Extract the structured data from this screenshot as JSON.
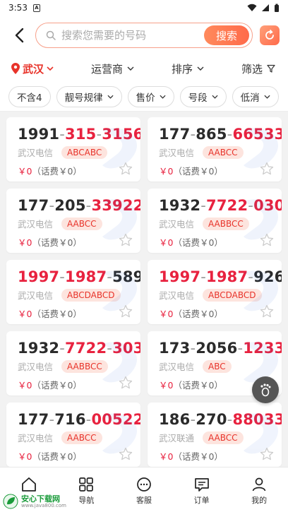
{
  "status": {
    "time": "3:53"
  },
  "search": {
    "placeholder": "搜索您需要的号码",
    "button": "搜索"
  },
  "filters": {
    "city": "武汉",
    "operator": "运营商",
    "sort": "排序",
    "screen": "筛选"
  },
  "tags": [
    "不含4",
    "靓号规律",
    "售价",
    "号段",
    "低消"
  ],
  "numbers": [
    {
      "p1": "1991",
      "p2": "315",
      "p3": "3156",
      "hl": [
        false,
        true,
        true
      ],
      "carrier": "武汉电信",
      "pattern": "ABCABC",
      "price": "￥0",
      "fee": "（话费￥0）"
    },
    {
      "p1": "177",
      "p2": "865",
      "p3": "66533",
      "hl": [
        false,
        false,
        true
      ],
      "carrier": "武汉电信",
      "pattern": "AABCC",
      "price": "￥0",
      "fee": "（话费￥0）"
    },
    {
      "p1": "177",
      "p2": "205",
      "p3": "33922",
      "hl": [
        false,
        false,
        true
      ],
      "carrier": "武汉电信",
      "pattern": "AABCC",
      "price": "￥0",
      "fee": "（话费￥0）"
    },
    {
      "p1": "1932",
      "p2": "7722",
      "p3": "030",
      "hl": [
        false,
        true,
        true
      ],
      "carrier": "武汉电信",
      "pattern": "AABBCC",
      "price": "￥0",
      "fee": "（话费￥0）"
    },
    {
      "p1": "1997",
      "p2": "1987",
      "p3": "589",
      "hl": [
        true,
        true,
        false
      ],
      "carrier": "武汉电信",
      "pattern": "ABCDABCD",
      "price": "￥0",
      "fee": "（话费￥0）"
    },
    {
      "p1": "1997",
      "p2": "1987",
      "p3": "926",
      "hl": [
        true,
        true,
        false
      ],
      "carrier": "武汉电信",
      "pattern": "ABCDABCD",
      "price": "￥0",
      "fee": "（话费￥0）"
    },
    {
      "p1": "1932",
      "p2": "7722",
      "p3": "303",
      "hl": [
        false,
        true,
        true
      ],
      "carrier": "武汉电信",
      "pattern": "AABBCC",
      "price": "￥0",
      "fee": "（话费￥0）"
    },
    {
      "p1": "173",
      "p2": "2056",
      "p3": "1233",
      "hl": [
        false,
        false,
        true
      ],
      "carrier": "武汉电信",
      "pattern": "ABC",
      "price": "￥0",
      "fee": "（话费￥0）"
    },
    {
      "p1": "177",
      "p2": "716",
      "p3": "00522",
      "hl": [
        false,
        false,
        true
      ],
      "carrier": "武汉电信",
      "pattern": "AABCC",
      "price": "￥0",
      "fee": "（话费￥0）"
    },
    {
      "p1": "186",
      "p2": "270",
      "p3": "88033",
      "hl": [
        false,
        false,
        true
      ],
      "carrier": "武汉联通",
      "pattern": "AABCC",
      "price": "￥0",
      "fee": "（话费￥0）"
    }
  ],
  "tabs": [
    {
      "icon": "home-icon",
      "label": ""
    },
    {
      "icon": "grid-icon",
      "label": "导航"
    },
    {
      "icon": "chat-icon",
      "label": "客服"
    },
    {
      "icon": "order-icon",
      "label": "订单"
    },
    {
      "icon": "user-icon",
      "label": "我的"
    }
  ],
  "watermark": {
    "text": "安心下载网",
    "url": "www.java800.com"
  },
  "colors": {
    "accent": "#e8223f",
    "brand": "#ff6a4a"
  }
}
